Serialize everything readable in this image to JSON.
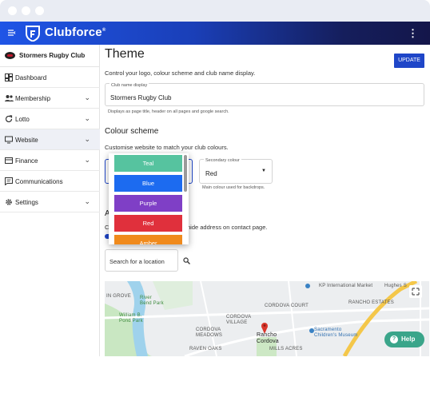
{
  "brand": {
    "name": "Clubforce",
    "reg": "®"
  },
  "club": {
    "name": "Stormers Rugby Club"
  },
  "sidebar": {
    "items": [
      {
        "label": "Dashboard",
        "icon": "dashboard-icon"
      },
      {
        "label": "Membership",
        "icon": "people-icon"
      },
      {
        "label": "Lotto",
        "icon": "refresh-icon"
      },
      {
        "label": "Website",
        "icon": "monitor-icon"
      },
      {
        "label": "Finance",
        "icon": "card-icon"
      },
      {
        "label": "Communications",
        "icon": "chat-icon"
      },
      {
        "label": "Settings",
        "icon": "gear-icon"
      }
    ]
  },
  "page": {
    "title": "Theme",
    "update_label": "UPDATE",
    "description": "Control your logo, colour scheme and club name display.",
    "club_name_field": {
      "label": "Club name display",
      "value": "Stormers Rugby Club",
      "hint": "Displays as page title, header on all pages and google search."
    },
    "colour_scheme": {
      "heading": "Colour scheme",
      "description": "Customise website to match your club colours.",
      "secondary": {
        "label": "Secondary colour",
        "value": "Red",
        "hint": "Main colour used for backdrops."
      }
    },
    "address": {
      "heading_fragment": "A",
      "text_fragment_left": "C",
      "text_fragment_right": "hide address on contact page."
    },
    "search": {
      "placeholder": "Search for a location"
    },
    "help_label": "Help"
  },
  "dropdown": {
    "options": [
      {
        "label": "Teal",
        "color": "#56c39f"
      },
      {
        "label": "Blue",
        "color": "#1c6bf0"
      },
      {
        "label": "Purple",
        "color": "#7f3fc6"
      },
      {
        "label": "Red",
        "color": "#e0303c"
      },
      {
        "label": "Amber",
        "color": "#f08a1c"
      }
    ]
  },
  "map": {
    "labels": {
      "kp": "KP International Market",
      "hughes": "Hughes S",
      "in_grove": "IN GROVE",
      "river_bend": "River\nBend Park",
      "cordova_court": "CORDOVA COURT",
      "rancho_estates": "RANCHO ESTATES",
      "william_b": "William B.\nPond Park",
      "cordova_village": "CORDOVA\nVILLAGE",
      "cordova_meadows": "CORDOVA\nMEADOWS",
      "rancho_cordova": "Rancho\nCordova",
      "sacramento": "Sacramento\nChildren's Museum",
      "raven_oaks": "RAVEN OAKS",
      "mills_acres": "MILLS ACRES"
    }
  },
  "colors": {
    "accent": "#1f46c8",
    "help": "#3aa58a",
    "club_red": "#c2162b"
  }
}
